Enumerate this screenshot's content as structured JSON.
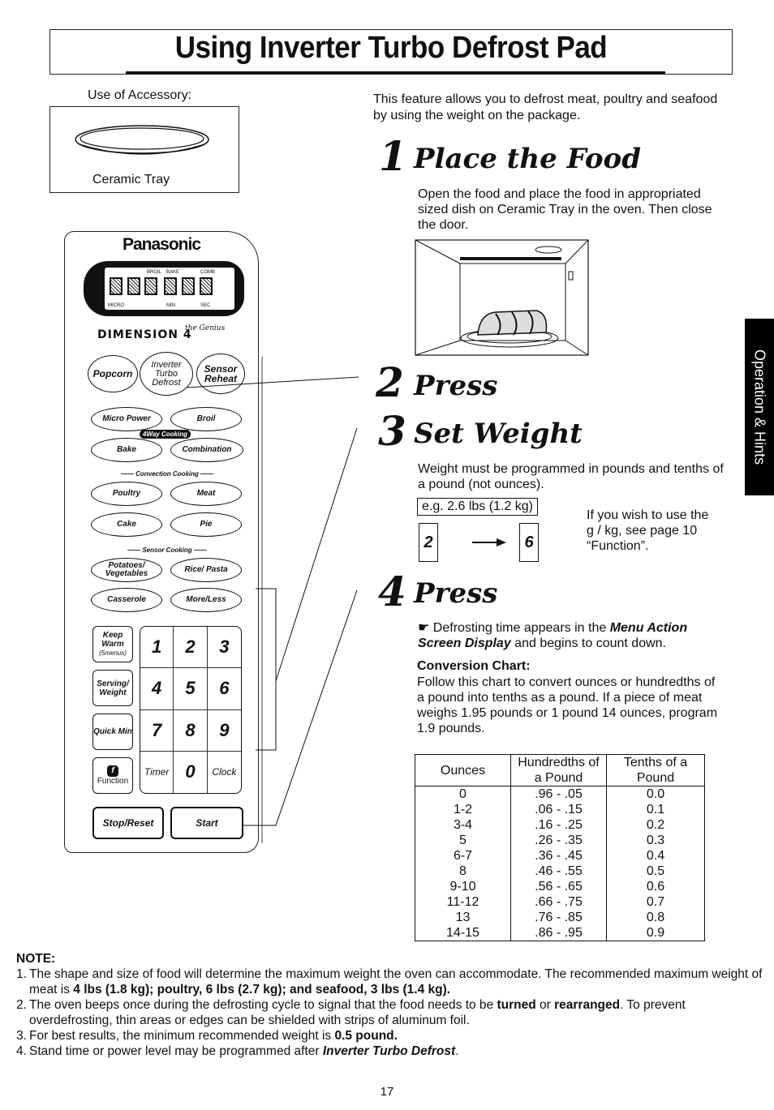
{
  "header": {
    "title": "Using Inverter Turbo Defrost Pad"
  },
  "accessory": {
    "label": "Use of Accessory:",
    "caption": "Ceramic Tray"
  },
  "intro": "This feature allows you to defrost meat, poultry and seafood by using the weight on the package.",
  "side_tab": "Operation & Hints",
  "steps": [
    {
      "number": "1",
      "title": "Place the Food",
      "text": "Open the food and place the food in appropriated sized dish on Ceramic Tray in the oven. Then close the door."
    },
    {
      "number": "2",
      "title": "Press"
    },
    {
      "number": "3",
      "title": "Set Weight",
      "text": "Weight must be programmed in pounds and tenths of a pound (not ounces).",
      "example": "e.g. 2.6 lbs (1.2 kg)",
      "keys": [
        "2",
        "6"
      ],
      "note": "If you wish to use the g / kg, see page 10 “Function”."
    },
    {
      "number": "4",
      "title": "Press",
      "bullet_pre": "Defrosting time appears in the ",
      "bullet_em": "Menu Action Screen Display",
      "bullet_post": " and begins to count down."
    }
  ],
  "conversion": {
    "title": "Conversion Chart:",
    "text": "Follow this chart to convert ounces or hundredths of a pound into tenths as a pound. If a piece of meat weighs 1.95 pounds or 1 pound 14 ounces, program 1.9 pounds.",
    "headers": [
      "Ounces",
      "Hundredths of a Pound",
      "Tenths of a Pound"
    ],
    "rows": [
      [
        "0",
        ".96 - .05",
        "0.0"
      ],
      [
        "1-2",
        ".06 - .15",
        "0.1"
      ],
      [
        "3-4",
        ".16 - .25",
        "0.2"
      ],
      [
        "5",
        ".26 - .35",
        "0.3"
      ],
      [
        "6-7",
        ".36 - .45",
        "0.4"
      ],
      [
        "8",
        ".46 - .55",
        "0.5"
      ],
      [
        "9-10",
        ".56 - .65",
        "0.6"
      ],
      [
        "11-12",
        ".66 - .75",
        "0.7"
      ],
      [
        "13",
        ".76 - .85",
        "0.8"
      ],
      [
        "14-15",
        ".86 - .95",
        "0.9"
      ]
    ]
  },
  "panel": {
    "brand": "Panasonic",
    "lcd_labels": {
      "broil": "BROIL",
      "bake": "BAKE",
      "comb": "COMB",
      "micro": "MICRO",
      "min": "MIN",
      "sec": "SEC"
    },
    "model": "DIMENSION 4",
    "model_suffix": "the Genius",
    "top_buttons": [
      "Popcorn",
      "Inverter Turbo Defrost",
      "Sensor Reheat"
    ],
    "cooking_buttons": [
      "Micro Power",
      "Broil",
      "Bake",
      "Combination"
    ],
    "four_way": "4Way Cooking",
    "convection_label": "Convection Cooking",
    "convection_buttons": [
      "Poultry",
      "Meat",
      "Cake",
      "Pie"
    ],
    "sensor_label": "Sensor Cooking",
    "sensor_buttons": [
      "Potatoes/ Vegetables",
      "Rice/ Pasta",
      "Casserole",
      "More/Less"
    ],
    "side_buttons": [
      "Keep Warm",
      "(5menus)",
      "Serving/ Weight",
      "Quick Min",
      "Function"
    ],
    "keypad": [
      "1",
      "2",
      "3",
      "4",
      "5",
      "6",
      "7",
      "8",
      "9",
      "Timer",
      "0",
      "Clock"
    ],
    "stop": "Stop/Reset",
    "start": "Start"
  },
  "notes": {
    "title": "NOTE:",
    "items": [
      {
        "n": "1.",
        "pre": "The shape and size of food will determine the maximum weight the oven can accommodate. The recommended maximum weight of meat is ",
        "bold": "4 lbs (1.8 kg); poultry, 6 lbs (2.7 kg); and seafood, 3 lbs (1.4 kg).",
        "post": ""
      },
      {
        "n": "2.",
        "pre": "The oven beeps once during the defrosting cycle to signal that the food needs to be ",
        "bold": "turned",
        "mid": " or ",
        "bold2": "rearranged",
        "post": ". To prevent overdefrosting, thin areas or edges can be shielded with strips of aluminum foil."
      },
      {
        "n": "3.",
        "pre": "For best results, the minimum recommended weight is ",
        "bold": "0.5 pound.",
        "post": ""
      },
      {
        "n": "4.",
        "pre": "Stand time or power level may be programmed after ",
        "bold": "Inverter Turbo Defrost",
        "post": "."
      }
    ]
  },
  "page_number": "17"
}
